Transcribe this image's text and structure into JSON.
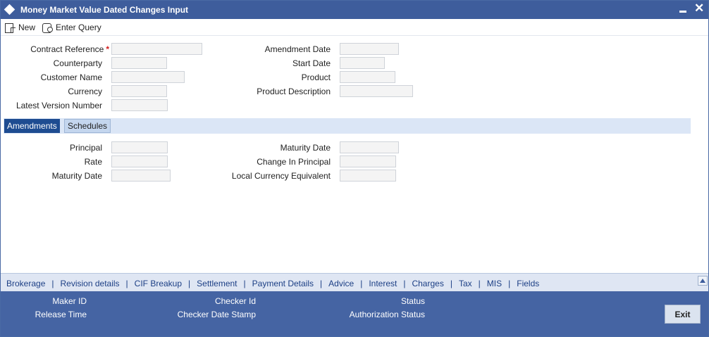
{
  "window": {
    "title": "Money Market Value Dated Changes Input",
    "icon": "diamond-icon",
    "minimize_icon": "minimize-icon",
    "close_label": "✕"
  },
  "toolbar": {
    "new_label": "New",
    "enter_query_label": "Enter Query"
  },
  "header_fields": {
    "contract_reference": {
      "label": "Contract Reference",
      "required_mark": "*",
      "value": ""
    },
    "counterparty": {
      "label": "Counterparty",
      "value": ""
    },
    "customer_name": {
      "label": "Customer Name",
      "value": ""
    },
    "currency": {
      "label": "Currency",
      "value": ""
    },
    "latest_version_number": {
      "label": "Latest Version Number",
      "value": ""
    },
    "amendment_date": {
      "label": "Amendment Date",
      "value": ""
    },
    "start_date": {
      "label": "Start Date",
      "value": ""
    },
    "product": {
      "label": "Product",
      "value": ""
    },
    "product_description": {
      "label": "Product Description",
      "value": ""
    }
  },
  "tabs": [
    {
      "label": "Amendments",
      "active": true
    },
    {
      "label": "Schedules",
      "active": false
    }
  ],
  "amendments": {
    "principal": {
      "label": "Principal",
      "value": ""
    },
    "rate": {
      "label": "Rate",
      "value": ""
    },
    "maturity_date_left": {
      "label": "Maturity Date",
      "value": ""
    },
    "maturity_date_right": {
      "label": "Maturity Date",
      "value": ""
    },
    "change_in_principal": {
      "label": "Change In Principal",
      "value": ""
    },
    "local_currency_equivalent": {
      "label": "Local Currency Equivalent",
      "value": ""
    }
  },
  "links": [
    "Brokerage",
    "Revision details",
    "CIF Breakup",
    "Settlement",
    "Payment Details",
    "Advice",
    "Interest",
    "Charges",
    "Tax",
    "MIS",
    "Fields"
  ],
  "link_separator": "|",
  "footer": {
    "maker_id": "Maker ID",
    "release_time": "Release Time",
    "checker_id": "Checker Id",
    "checker_date_stamp": "Checker Date Stamp",
    "status": "Status",
    "authorization_status": "Authorization Status",
    "exit_label": "Exit"
  },
  "colors": {
    "titlebar": "#3e5d9c",
    "active_tab": "#1e4c91",
    "footer": "#4564a3",
    "required": "#d21c1c",
    "link": "#1c3f85"
  }
}
